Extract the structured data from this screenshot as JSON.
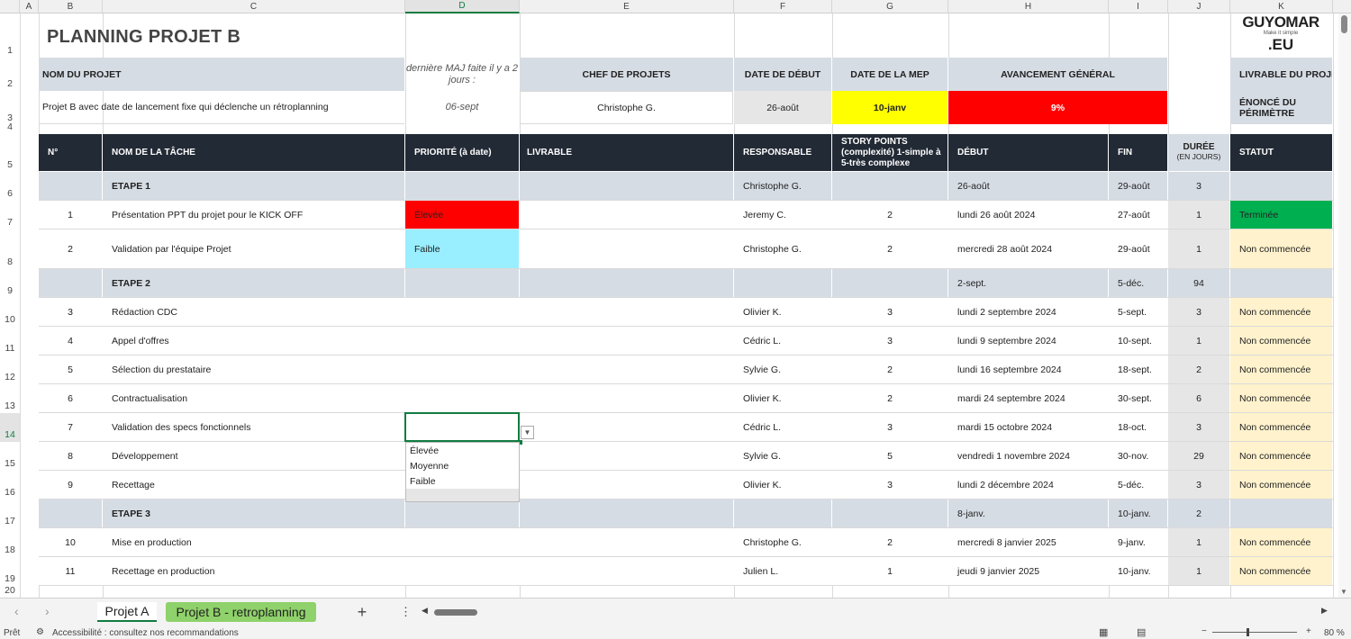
{
  "columns": [
    "A",
    "B",
    "C",
    "D",
    "E",
    "F",
    "G",
    "H",
    "I",
    "J",
    "K"
  ],
  "rows": [
    "1",
    "2",
    "3",
    "4",
    "5",
    "6",
    "7",
    "8",
    "9",
    "10",
    "11",
    "12",
    "13",
    "14",
    "15",
    "16",
    "17",
    "18",
    "19",
    "20"
  ],
  "logo": {
    "line1": "GUYOMAR",
    "tagline": "Make it simple",
    "line2": ".EU"
  },
  "title": "PLANNING PROJET B",
  "project": {
    "name_label": "NOM DU PROJET",
    "name_value": "Projet B avec date de lancement fixe qui déclenche un rétroplanning",
    "update_note": "dernière MAJ faite il y a 2 jours :",
    "update_date": "06-sept",
    "chef_label": "CHEF DE PROJETS",
    "chef_value": "Christophe G.",
    "start_label": "DATE DE DÉBUT",
    "start_value": "26-août",
    "mep_label": "DATE DE LA MEP",
    "mep_value": "10-janv",
    "progress_label": "AVANCEMENT GÉNÉRAL",
    "progress_value": "9%",
    "livrable_label": "LIVRABLE DU PROJET",
    "enonce_label": "ÉNONCÉ DU PÉRIMÈTRE"
  },
  "table_headers": {
    "num": "N°",
    "task": "NOM DE LA TÂCHE",
    "priority": "PRIORITÉ (à date)",
    "livrable": "LIVRABLE",
    "responsable": "RESPONSABLE",
    "story": "STORY POINTS (complexité) 1-simple à 5-très complexe",
    "debut": "DÉBUT",
    "fin": "FIN",
    "duree": "DURÉE",
    "duree_sub": "(EN JOURS)",
    "statut": "STATUT"
  },
  "table_rows": [
    {
      "type": "etape",
      "num": "",
      "task": "ETAPE 1",
      "priority": "",
      "livrable": "",
      "resp": "Christophe G.",
      "sp": "",
      "debut": "26-août",
      "fin": "29-août",
      "duree": "3",
      "statut": ""
    },
    {
      "type": "task",
      "num": "1",
      "task": "Présentation PPT du projet pour le KICK OFF",
      "priority": "Élevée",
      "livrable": "",
      "resp": "Jeremy C.",
      "sp": "2",
      "debut": "lundi 26 août 2024",
      "fin": "27-août",
      "duree": "1",
      "statut": "Terminée"
    },
    {
      "type": "task",
      "num": "2",
      "task": "Validation par l'équipe Projet",
      "priority": "Faible",
      "livrable": "",
      "resp": "Christophe G.",
      "sp": "2",
      "debut": "mercredi 28 août 2024",
      "fin": "29-août",
      "duree": "1",
      "statut": "Non commencée"
    },
    {
      "type": "etape",
      "num": "",
      "task": "ETAPE 2",
      "priority": "",
      "livrable": "",
      "resp": "",
      "sp": "",
      "debut": "2-sept.",
      "fin": "5-déc.",
      "duree": "94",
      "statut": ""
    },
    {
      "type": "task",
      "num": "3",
      "task": "Rédaction CDC",
      "priority": "",
      "livrable": "",
      "resp": "Olivier K.",
      "sp": "3",
      "debut": "lundi 2 septembre 2024",
      "fin": "5-sept.",
      "duree": "3",
      "statut": "Non commencée"
    },
    {
      "type": "task",
      "num": "4",
      "task": "Appel d'offres",
      "priority": "",
      "livrable": "",
      "resp": "Cédric L.",
      "sp": "3",
      "debut": "lundi 9 septembre 2024",
      "fin": "10-sept.",
      "duree": "1",
      "statut": "Non commencée"
    },
    {
      "type": "task",
      "num": "5",
      "task": "Sélection du prestataire",
      "priority": "",
      "livrable": "",
      "resp": "Sylvie G.",
      "sp": "2",
      "debut": "lundi 16 septembre 2024",
      "fin": "18-sept.",
      "duree": "2",
      "statut": "Non commencée"
    },
    {
      "type": "task",
      "num": "6",
      "task": "Contractualisation",
      "priority": "",
      "livrable": "",
      "resp": "Olivier K.",
      "sp": "2",
      "debut": "mardi 24 septembre 2024",
      "fin": "30-sept.",
      "duree": "6",
      "statut": "Non commencée"
    },
    {
      "type": "task",
      "num": "7",
      "task": "Validation des specs fonctionnels",
      "priority": "",
      "livrable": "",
      "resp": "Cédric L.",
      "sp": "3",
      "debut": "mardi 15 octobre 2024",
      "fin": "18-oct.",
      "duree": "3",
      "statut": "Non commencée"
    },
    {
      "type": "task",
      "num": "8",
      "task": "Développement",
      "priority": "",
      "livrable": "",
      "resp": "Sylvie G.",
      "sp": "5",
      "debut": "vendredi 1 novembre 2024",
      "fin": "30-nov.",
      "duree": "29",
      "statut": "Non commencée"
    },
    {
      "type": "task",
      "num": "9",
      "task": "Recettage",
      "priority": "",
      "livrable": "",
      "resp": "Olivier K.",
      "sp": "3",
      "debut": "lundi 2 décembre 2024",
      "fin": "5-déc.",
      "duree": "3",
      "statut": "Non commencée"
    },
    {
      "type": "etape",
      "num": "",
      "task": "ETAPE 3",
      "priority": "",
      "livrable": "",
      "resp": "",
      "sp": "",
      "debut": "8-janv.",
      "fin": "10-janv.",
      "duree": "2",
      "statut": ""
    },
    {
      "type": "task",
      "num": "10",
      "task": "Mise en production",
      "priority": "",
      "livrable": "",
      "resp": "Christophe G.",
      "sp": "2",
      "debut": "mercredi 8 janvier 2025",
      "fin": "9-janv.",
      "duree": "1",
      "statut": "Non commencée"
    },
    {
      "type": "task",
      "num": "11",
      "task": "Recettage en production",
      "priority": "",
      "livrable": "",
      "resp": "Julien L.",
      "sp": "1",
      "debut": "jeudi 9 janvier 2025",
      "fin": "10-janv.",
      "duree": "1",
      "statut": "Non commencée"
    }
  ],
  "dropdown": {
    "options": [
      "Élevée",
      "Moyenne",
      "Faible"
    ]
  },
  "tabs": {
    "tab1": "Projet A",
    "tab2": "Projet B - retroplanning",
    "add": "+"
  },
  "status": {
    "ready": "Prêt",
    "accessibility": "Accessibilité : consultez nos recommandations",
    "zoom": "80 %"
  },
  "colors": {
    "etape": "#d6dce4",
    "header_dark": "#222a35",
    "priority_high": "#ff0000",
    "priority_low": "#99eeff",
    "status_done": "#00b050",
    "status_todo": "#fff2cc",
    "mep": "#ffff00",
    "progress": "#ff0000",
    "active_tab": "#8fd16a"
  }
}
